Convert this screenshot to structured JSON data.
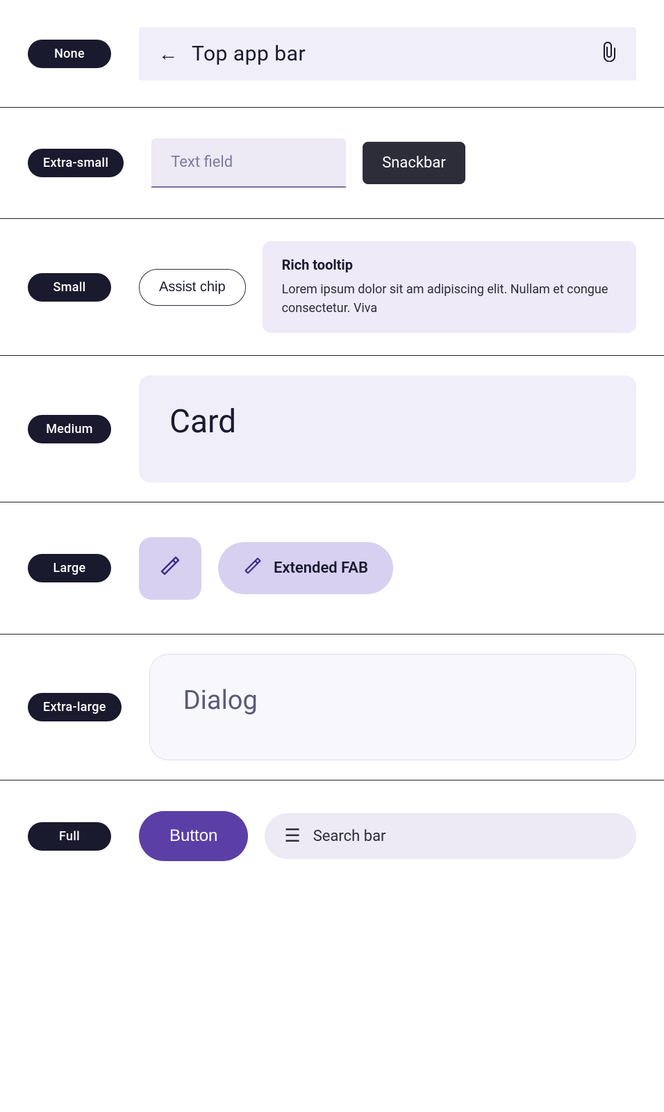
{
  "sections": {
    "none": {
      "badge": "None",
      "topbar": {
        "title": "Top app bar",
        "back_arrow": "←",
        "paperclip": "🖇"
      }
    },
    "extra_small": {
      "badge": "Extra-small",
      "text_field": {
        "placeholder": "Text field"
      },
      "snackbar": {
        "label": "Snackbar"
      }
    },
    "small": {
      "badge": "Small",
      "assist_chip": {
        "label": "Assist chip"
      },
      "rich_tooltip": {
        "title": "Rich tooltip",
        "body": "Lorem ipsum dolor sit am adipiscing elit. Nullam et congue consectetur. Viva"
      }
    },
    "medium": {
      "badge": "Medium",
      "card": {
        "title": "Card"
      }
    },
    "large": {
      "badge": "Large",
      "fab": {
        "icon": "✏",
        "aria": "FAB"
      },
      "extended_fab": {
        "icon": "✏",
        "label": "Extended FAB"
      }
    },
    "extra_large": {
      "badge": "Extra-large",
      "dialog": {
        "title": "Dialog"
      }
    },
    "full": {
      "badge": "Full",
      "button": {
        "label": "Button"
      },
      "search_bar": {
        "label": "Search bar",
        "icon": "☰"
      }
    }
  }
}
